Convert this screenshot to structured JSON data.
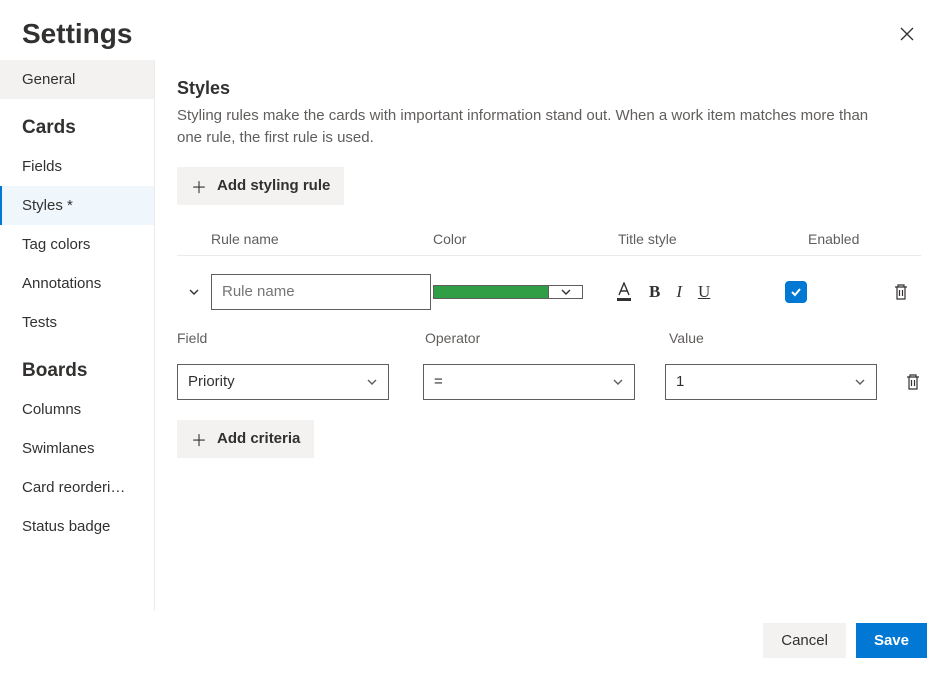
{
  "title": "Settings",
  "sidebar": {
    "general": "General",
    "groups": [
      {
        "title": "Cards",
        "items": [
          "Fields",
          "Styles *",
          "Tag colors",
          "Annotations",
          "Tests"
        ]
      },
      {
        "title": "Boards",
        "items": [
          "Columns",
          "Swimlanes",
          "Card reorderi…",
          "Status badge"
        ]
      }
    ]
  },
  "main": {
    "heading": "Styles",
    "description": "Styling rules make the cards with important information stand out. When a work item matches more than one rule, the first rule is used.",
    "add_rule": "Add styling rule",
    "columns": {
      "name": "Rule name",
      "color": "Color",
      "title_style": "Title style",
      "enabled": "Enabled"
    },
    "rule": {
      "name_placeholder": "Rule name",
      "color": "#2f9e44",
      "enabled": true
    },
    "criteria_cols": {
      "field": "Field",
      "operator": "Operator",
      "value": "Value"
    },
    "criteria": {
      "field": "Priority",
      "operator": "=",
      "value": "1"
    },
    "add_criteria": "Add criteria"
  },
  "footer": {
    "cancel": "Cancel",
    "save": "Save"
  }
}
